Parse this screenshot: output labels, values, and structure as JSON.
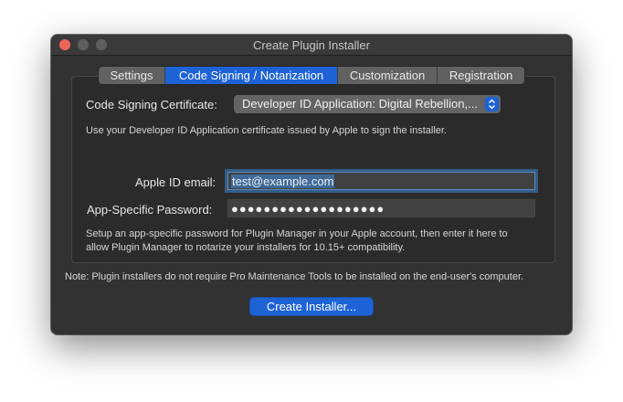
{
  "window": {
    "title": "Create Plugin Installer",
    "close_color": "#ec6559"
  },
  "tabs": [
    {
      "label": "Settings",
      "active": false
    },
    {
      "label": "Code Signing / Notarization",
      "active": true
    },
    {
      "label": "Customization",
      "active": false
    },
    {
      "label": "Registration",
      "active": false
    }
  ],
  "signing": {
    "certificate_label": "Code Signing Certificate:",
    "certificate_value": "Developer ID Application: Digital Rebellion,...",
    "certificate_help": "Use your Developer ID Application certificate issued by Apple to sign the installer."
  },
  "notarization": {
    "email_label": "Apple ID email:",
    "email_value": "test@example.com",
    "password_label": "App-Specific Password:",
    "password_value": "●●●●●●●●●●●●●●●●●●●",
    "help_line1": "Setup an app-specific password for Plugin Manager in your Apple account, then enter it here to",
    "help_line2": "allow Plugin Manager to notarize your installers for 10.15+ compatibility."
  },
  "note": "Note: Plugin installers do not require Pro Maintenance Tools to be installed on the end-user's computer.",
  "create_button_label": "Create Installer...",
  "accent_color": "#1e63d6"
}
